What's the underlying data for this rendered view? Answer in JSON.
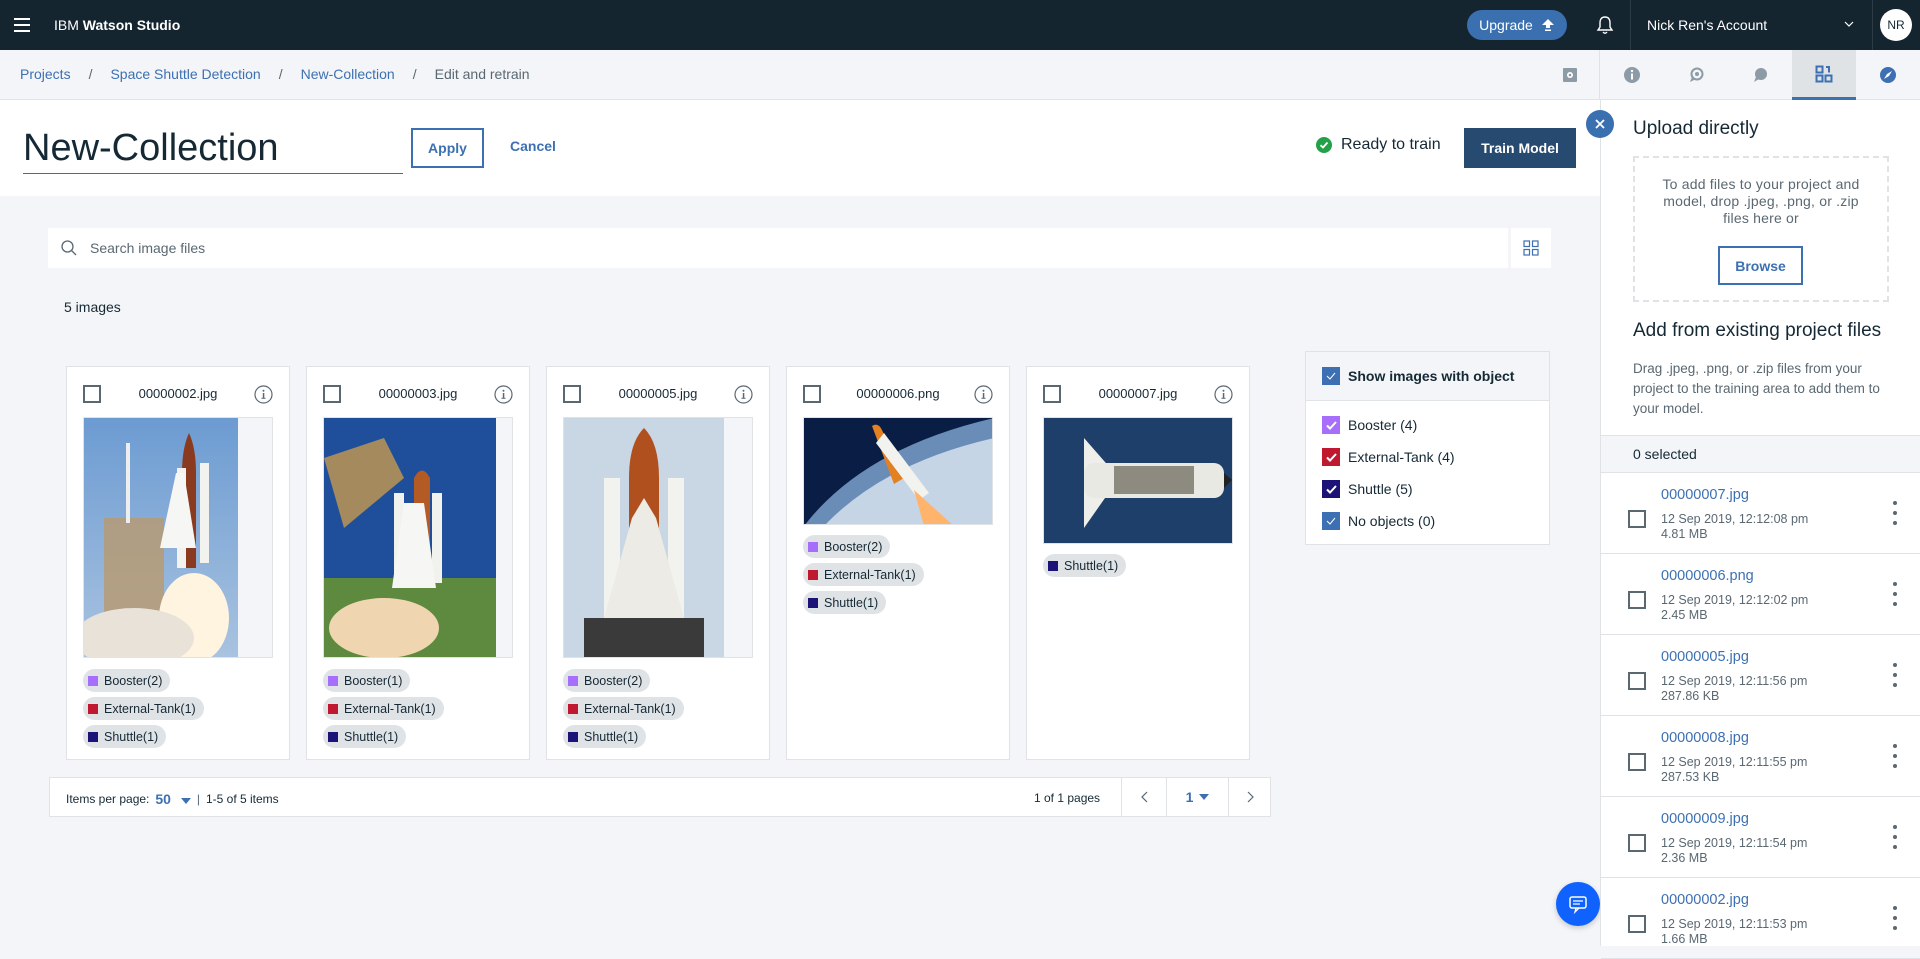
{
  "topbar": {
    "brand_prefix": "IBM",
    "brand_name": "Watson Studio",
    "upgrade_label": "Upgrade",
    "account_label": "Nick Ren's Account",
    "avatar_initials": "NR"
  },
  "breadcrumb": [
    {
      "label": "Projects"
    },
    {
      "label": "Space Shuttle Detection"
    },
    {
      "label": "New-Collection"
    },
    {
      "label": "Edit and retrain"
    }
  ],
  "header": {
    "collection_name": "New-Collection",
    "apply_label": "Apply",
    "cancel_label": "Cancel",
    "status_label": "Ready to train",
    "train_label": "Train Model"
  },
  "search": {
    "placeholder": "Search image files"
  },
  "image_count": "5 images",
  "colors": {
    "booster": "#a66efa",
    "external_tank": "#c0192f",
    "shuttle": "#1c1278",
    "accent": "#3d70b2",
    "success": "#24a148"
  },
  "cards": [
    {
      "file": "00000002.jpg",
      "tags": [
        {
          "label": "Booster(2)",
          "type": "booster"
        },
        {
          "label": "External-Tank(1)",
          "type": "external_tank"
        },
        {
          "label": "Shuttle(1)",
          "type": "shuttle"
        }
      ]
    },
    {
      "file": "00000003.jpg",
      "tags": [
        {
          "label": "Booster(1)",
          "type": "booster"
        },
        {
          "label": "External-Tank(1)",
          "type": "external_tank"
        },
        {
          "label": "Shuttle(1)",
          "type": "shuttle"
        }
      ]
    },
    {
      "file": "00000005.jpg",
      "tags": [
        {
          "label": "Booster(2)",
          "type": "booster"
        },
        {
          "label": "External-Tank(1)",
          "type": "external_tank"
        },
        {
          "label": "Shuttle(1)",
          "type": "shuttle"
        }
      ]
    },
    {
      "file": "00000006.png",
      "tags": [
        {
          "label": "Booster(2)",
          "type": "booster"
        },
        {
          "label": "External-Tank(1)",
          "type": "external_tank"
        },
        {
          "label": "Shuttle(1)",
          "type": "shuttle"
        }
      ]
    },
    {
      "file": "00000007.jpg",
      "tags": [
        {
          "label": "Shuttle(1)",
          "type": "shuttle"
        }
      ]
    }
  ],
  "filter": {
    "header": "Show images with object",
    "items": [
      {
        "label": "Booster (4)",
        "type": "booster",
        "checked": true
      },
      {
        "label": "External-Tank (4)",
        "type": "external_tank",
        "checked": true
      },
      {
        "label": "Shuttle (5)",
        "type": "shuttle",
        "checked": true
      },
      {
        "label": "No objects (0)",
        "type": "none",
        "checked": true
      }
    ]
  },
  "pagination": {
    "items_per_page_label": "Items per page:",
    "items_per_page": "50",
    "range": "1-5 of 5 items",
    "pages": "1 of 1 pages",
    "current_page": "1"
  },
  "panel": {
    "upload_title": "Upload directly",
    "drop_text": "To add files to your project and model, drop .jpeg, .png, or .zip files here or",
    "browse_label": "Browse",
    "existing_title": "Add from existing project files",
    "existing_desc": "Drag .jpeg, .png, or .zip files from your project to the training area to add them to your model.",
    "selected": "0 selected",
    "files": [
      {
        "name": "00000007.jpg",
        "date": "12 Sep 2019, 12:12:08 pm",
        "size": "4.81 MB"
      },
      {
        "name": "00000006.png",
        "date": "12 Sep 2019, 12:12:02 pm",
        "size": "2.45 MB"
      },
      {
        "name": "00000005.jpg",
        "date": "12 Sep 2019, 12:11:56 pm",
        "size": "287.86 KB"
      },
      {
        "name": "00000008.jpg",
        "date": "12 Sep 2019, 12:11:55 pm",
        "size": "287.53 KB"
      },
      {
        "name": "00000009.jpg",
        "date": "12 Sep 2019, 12:11:54 pm",
        "size": "2.36 MB"
      },
      {
        "name": "00000002.jpg",
        "date": "12 Sep 2019, 12:11:53 pm",
        "size": "1.66 MB"
      }
    ]
  }
}
